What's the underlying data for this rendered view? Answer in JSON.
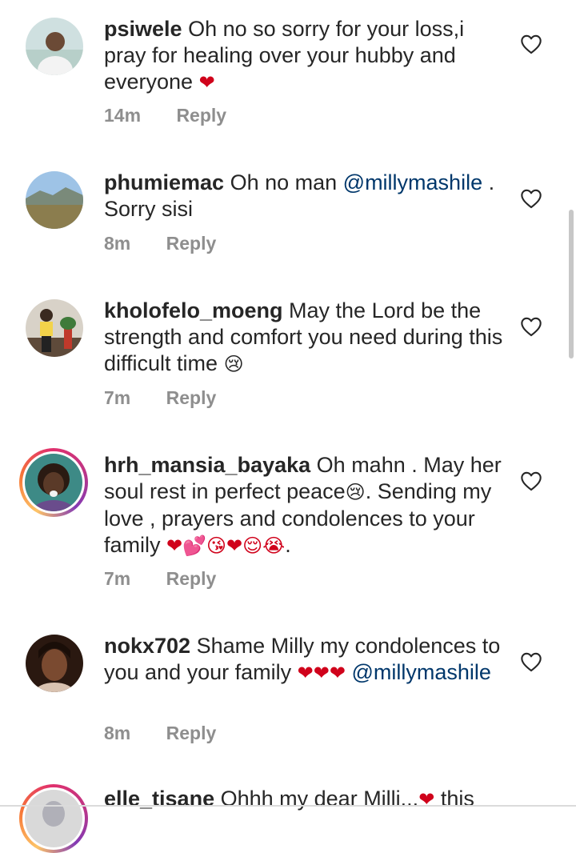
{
  "icons": {
    "like": "heart-outline-icon",
    "avatar": "profile-photo"
  },
  "colors": {
    "text": "#262626",
    "meta": "#8e8e8e",
    "mention": "#00376b",
    "heart": "#d0021b",
    "story_ring": "#e1306c"
  },
  "comments": [
    {
      "username": "psiwele",
      "text": "Oh no so sorry for your loss,i pray for healing over your hubby and everyone",
      "emoji": "❤",
      "time": "14m",
      "reply": "Reply"
    },
    {
      "username": "phumiemac",
      "text_before": "Oh no man",
      "mention": "@millymashile",
      "text_after": ". Sorry sisi",
      "time": "8m",
      "reply": "Reply"
    },
    {
      "username": "kholofelo_moeng",
      "text": "May the Lord be the strength and comfort you need during this difficult time",
      "emoji": "😢",
      "time": "7m",
      "reply": "Reply"
    },
    {
      "username": "hrh_mansia_bayaka",
      "text_1": "Oh mahn . May her soul rest in perfect peace",
      "emoji_1": "😢",
      "text_2": ". Sending my love , prayers and condolences to your family",
      "emoji_2": "❤💕😘❤😌😭",
      "text_3": ".",
      "time": "7m",
      "reply": "Reply"
    },
    {
      "username": "nokx702",
      "text": "Shame Milly my condolences to you and your family",
      "emoji": "❤❤❤",
      "mention": "@millymashile",
      "time": "8m",
      "reply": "Reply"
    },
    {
      "username": "elle_tisane",
      "text_before": "Ohhh my dear Milli...",
      "emoji": "❤",
      "text_after": "this"
    }
  ]
}
